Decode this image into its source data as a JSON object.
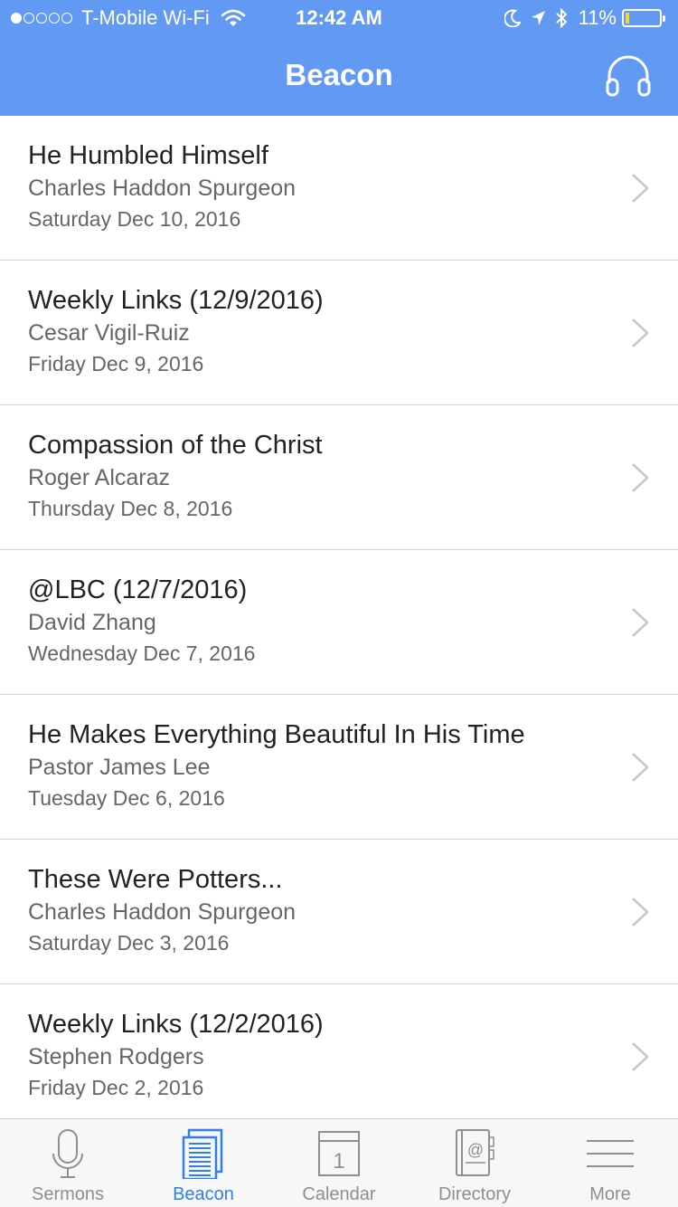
{
  "status_bar": {
    "carrier": "T-Mobile Wi-Fi",
    "time": "12:42 AM",
    "battery_percent": "11%",
    "battery_level": 0.11,
    "signal_bars_filled": 1,
    "signal_bars_total": 5
  },
  "header": {
    "title": "Beacon",
    "right_icon": "headphones-icon",
    "background": "#6299f3"
  },
  "items": [
    {
      "title": "He Humbled Himself",
      "author": "Charles Haddon Spurgeon",
      "date": "Saturday Dec 10, 2016"
    },
    {
      "title": "Weekly Links (12/9/2016)",
      "author": "Cesar Vigil-Ruiz",
      "date": "Friday Dec 9, 2016"
    },
    {
      "title": "Compassion of the Christ",
      "author": "Roger Alcaraz",
      "date": "Thursday Dec 8, 2016"
    },
    {
      "title": "@LBC (12/7/2016)",
      "author": "David Zhang",
      "date": "Wednesday Dec 7, 2016"
    },
    {
      "title": "He Makes Everything Beautiful In His Time",
      "author": "Pastor James Lee",
      "date": "Tuesday Dec 6, 2016"
    },
    {
      "title": "These Were Potters...",
      "author": "Charles Haddon Spurgeon",
      "date": "Saturday Dec 3, 2016"
    },
    {
      "title": "Weekly Links (12/2/2016)",
      "author": "Stephen Rodgers",
      "date": "Friday Dec 2, 2016"
    }
  ],
  "tabs": [
    {
      "label": "Sermons",
      "icon": "microphone-icon",
      "active": false
    },
    {
      "label": "Beacon",
      "icon": "document-icon",
      "active": true
    },
    {
      "label": "Calendar",
      "icon": "calendar-icon",
      "active": false,
      "icon_text": "1"
    },
    {
      "label": "Directory",
      "icon": "address-book-icon",
      "active": false,
      "icon_text": "@"
    },
    {
      "label": "More",
      "icon": "menu-icon",
      "active": false
    }
  ],
  "colors": {
    "accent": "#2f7fe6",
    "inactive_tab": "#8e8e93",
    "battery_fill": "#f6d53c"
  }
}
